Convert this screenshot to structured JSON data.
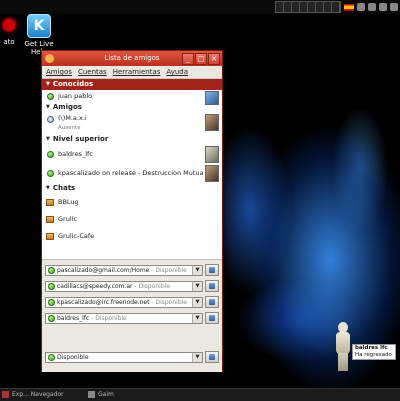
{
  "desktop": {
    "icons": [
      {
        "label": "ato",
        "name": "desktop-icon-left"
      },
      {
        "label": "Get Live Help",
        "name": "desktop-icon-get-live-help",
        "glyph": "K"
      }
    ]
  },
  "window": {
    "title": "Lista de amigos",
    "buttons": {
      "minimize": "_",
      "maximize": "□",
      "close": "✕"
    },
    "menu": [
      "Amigos",
      "Cuentas",
      "Herramientas",
      "Ayuda"
    ]
  },
  "groups": [
    {
      "name": "Conocidos",
      "contacts": [
        {
          "name": "juan pablo",
          "status": "online"
        }
      ]
    },
    {
      "name": "Amigos",
      "contacts": [
        {
          "name": "(\\)M.a.x.i",
          "sub": "Ausente",
          "status": "away"
        }
      ]
    },
    {
      "name": "Nivel superior",
      "contacts": [
        {
          "name": "baldres_lfc",
          "status": "online"
        },
        {
          "name": "kpascalizado on release - Destruccion Mutua A...",
          "status": "online"
        }
      ]
    },
    {
      "name": "Chats",
      "contacts": [
        {
          "name": "BBLug"
        },
        {
          "name": "Grulic"
        },
        {
          "name": "Grulic-Cafe"
        }
      ]
    }
  ],
  "accounts": [
    {
      "account": "pascalizado@gmail.com/Home",
      "status": "Disponible"
    },
    {
      "account": "cadillacs@speedy.com.ar",
      "status": "Disponible"
    },
    {
      "account": "kpascalizado@irc.freenode.net",
      "status": "Disponible"
    },
    {
      "account": "baldres_lfc",
      "status": "Disponible"
    }
  ],
  "global_status": "Disponible",
  "separator": " - ",
  "notification": {
    "name": "baldres lfc",
    "message": "Ha regresado"
  },
  "taskbar": [
    {
      "label": "Exp... Navegador"
    },
    {
      "label": "Gaim"
    }
  ],
  "colors": {
    "accent": "#a0241a",
    "title_bar": "#c9412c",
    "online": "#3aa02a"
  }
}
